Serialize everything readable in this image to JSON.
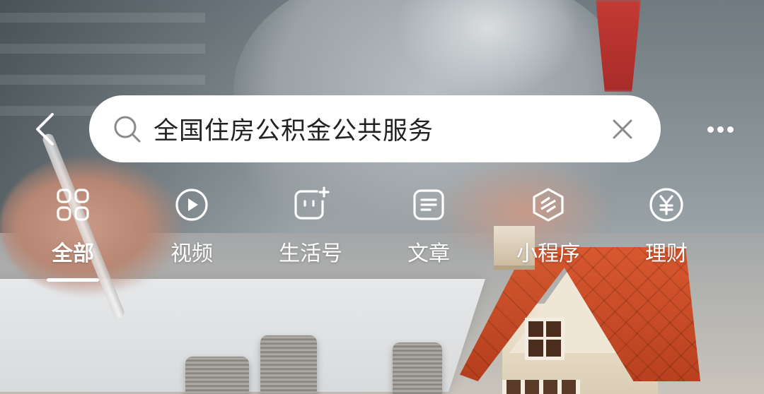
{
  "search": {
    "query": "全国住房公积金公共服务"
  },
  "icons": {
    "back": "chevron-left-icon",
    "search": "search-icon",
    "clear": "close-icon",
    "more": "more-dots-icon"
  },
  "tabs": [
    {
      "label": "全部",
      "icon": "grid-icon",
      "active": true
    },
    {
      "label": "视频",
      "icon": "play-icon",
      "active": false
    },
    {
      "label": "生活号",
      "icon": "smiley-sparkle-icon",
      "active": false
    },
    {
      "label": "文章",
      "icon": "document-icon",
      "active": false
    },
    {
      "label": "小程序",
      "icon": "mini-program-icon",
      "active": false
    },
    {
      "label": "理财",
      "icon": "yuan-icon",
      "active": false
    }
  ],
  "colors": {
    "text_on_image": "#ffffff",
    "search_bg": "#ffffff",
    "search_text": "#222222",
    "icon_gray": "#8a8a8a"
  }
}
